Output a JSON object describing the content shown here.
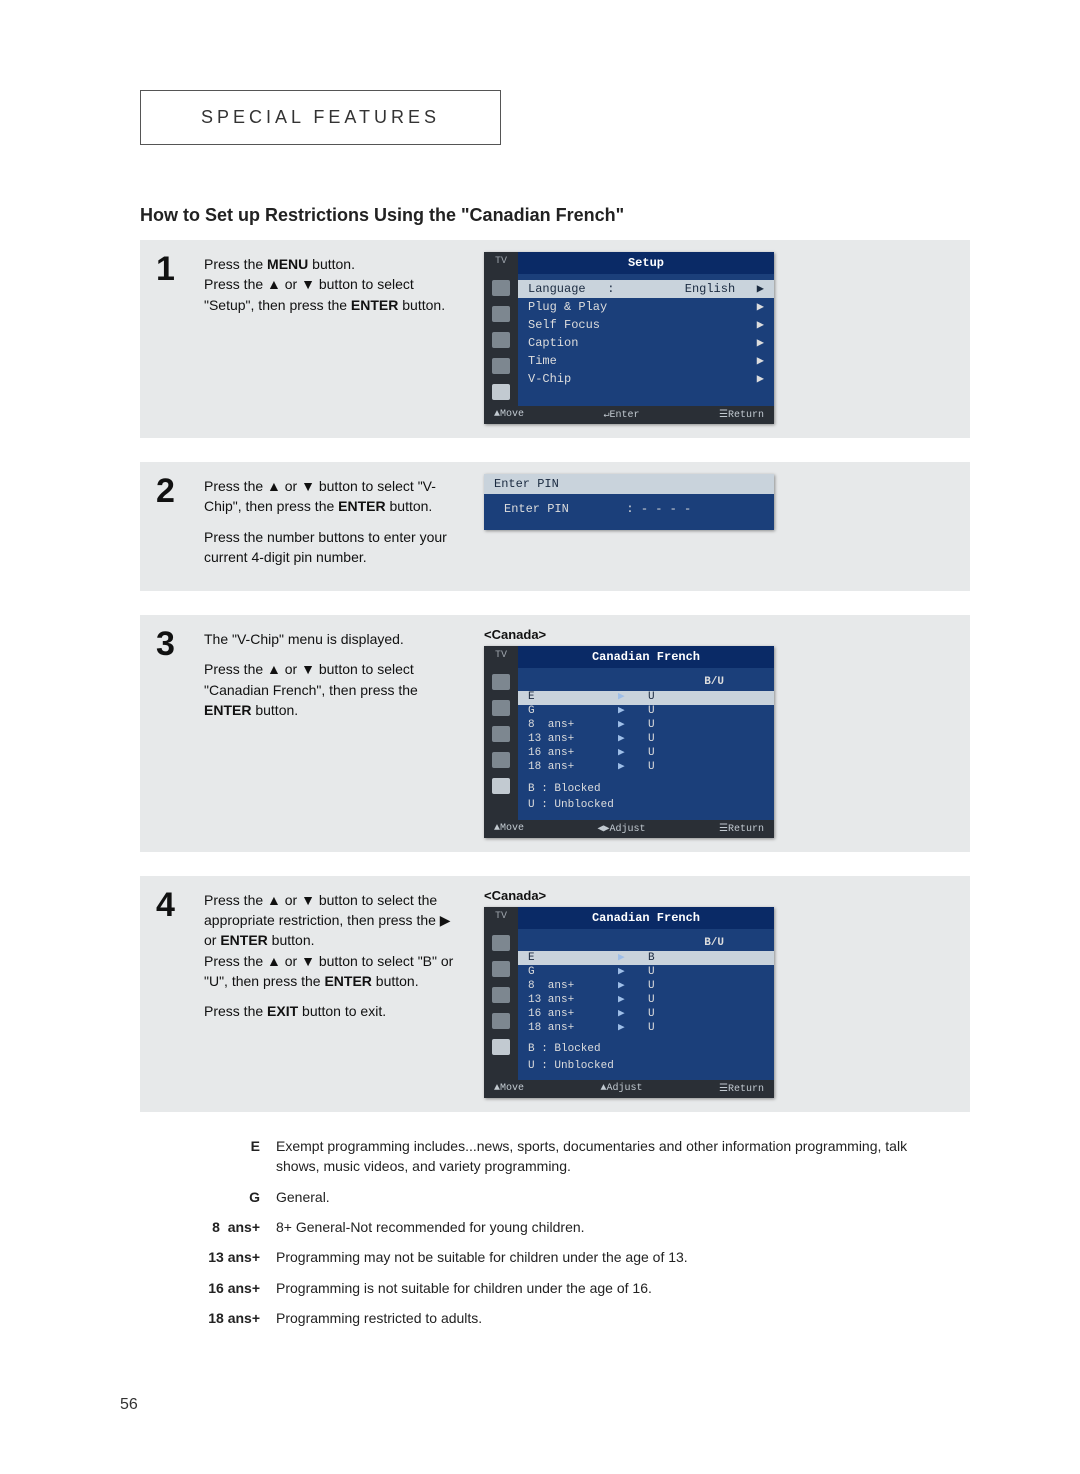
{
  "section_label": "SPECIAL  FEATURES",
  "subtitle": "How to Set up Restrictions Using the \"Canadian French\"",
  "page_number": "56",
  "steps": {
    "s1": {
      "num": "1",
      "p1a": "Press the ",
      "p1b": "MENU",
      "p1c": " button.",
      "p2a": "Press the ▲ or ▼ button to select \"Setup\", then press the ",
      "p2b": "ENTER",
      "p2c": " button."
    },
    "s2": {
      "num": "2",
      "p1a": "Press the ▲ or ▼ button to select \"V-Chip\", then press the ",
      "p1b": "ENTER",
      "p1c": " button.",
      "p2": "Press the number buttons to enter your current 4-digit pin number."
    },
    "s3": {
      "num": "3",
      "caption": "<Canada>",
      "p1": "The \"V-Chip\" menu is displayed.",
      "p2a": "Press the ▲ or ▼ button to select \"Canadian French\", then press the ",
      "p2b": "ENTER",
      "p2c": " button."
    },
    "s4": {
      "num": "4",
      "caption": "<Canada>",
      "p1a": "Press the ▲ or ▼ button to select the appropriate restriction, then press  the ▶ or ",
      "p1b": "ENTER",
      "p1c": " button.",
      "p2a": "Press the ▲ or ▼ button to select \"B\" or \"U\", then press the ",
      "p2b": "ENTER",
      "p2c": " button.",
      "p3a": "Press the ",
      "p3b": "EXIT",
      "p3c": " button to exit."
    }
  },
  "osd1": {
    "tv": "TV",
    "title": "Setup",
    "rows": [
      {
        "l": "Language   :",
        "r": "English   ▶",
        "hl": true
      },
      {
        "l": "Plug & Play",
        "r": "▶"
      },
      {
        "l": "Self Focus",
        "r": "▶"
      },
      {
        "l": "Caption",
        "r": "▶"
      },
      {
        "l": "Time",
        "r": "▶"
      },
      {
        "l": "V-Chip",
        "r": "▶"
      }
    ],
    "footer": {
      "a": "▲Move",
      "b": "↵Enter",
      "c": "☰Return"
    }
  },
  "osd2": {
    "title": "Enter PIN",
    "body": "Enter PIN        : - - - -"
  },
  "osd3": {
    "tv": "TV",
    "title": "Canadian French",
    "header": "B/U",
    "rows": [
      {
        "label": "E",
        "val": "U",
        "hl": true
      },
      {
        "label": "G",
        "val": "U"
      },
      {
        "label": "8  ans+",
        "val": "U"
      },
      {
        "label": "13 ans+",
        "val": "U"
      },
      {
        "label": "16 ans+",
        "val": "U"
      },
      {
        "label": "18 ans+",
        "val": "U"
      }
    ],
    "legend": "B : Blocked\nU : Unblocked",
    "footer": {
      "a": "▲Move",
      "b": "◀▶Adjust",
      "c": "☰Return"
    }
  },
  "osd4": {
    "tv": "TV",
    "title": "Canadian French",
    "header": "B/U",
    "rows": [
      {
        "label": "E",
        "val": "B",
        "hl": true
      },
      {
        "label": "G",
        "val": "U"
      },
      {
        "label": "8  ans+",
        "val": "U"
      },
      {
        "label": "13 ans+",
        "val": "U"
      },
      {
        "label": "16 ans+",
        "val": "U"
      },
      {
        "label": "18 ans+",
        "val": "U"
      }
    ],
    "legend": "B : Blocked\nU : Unblocked",
    "footer": {
      "a": "▲Move",
      "b": "▲Adjust",
      "c": "☰Return"
    }
  },
  "definitions": [
    {
      "key": "E",
      "val": "Exempt programming includes...news, sports, documentaries and other information programming, talk shows, music videos, and  variety programming."
    },
    {
      "key": "G",
      "val": "General."
    },
    {
      "key": "8  ans+",
      "val": "8+ General-Not recommended for young children."
    },
    {
      "key": "13 ans+",
      "val": "Programming may not be suitable for children under the age of 13."
    },
    {
      "key": "16 ans+",
      "val": "Programming is not suitable for children under the age of 16."
    },
    {
      "key": "18 ans+",
      "val": "Programming restricted to adults."
    }
  ]
}
